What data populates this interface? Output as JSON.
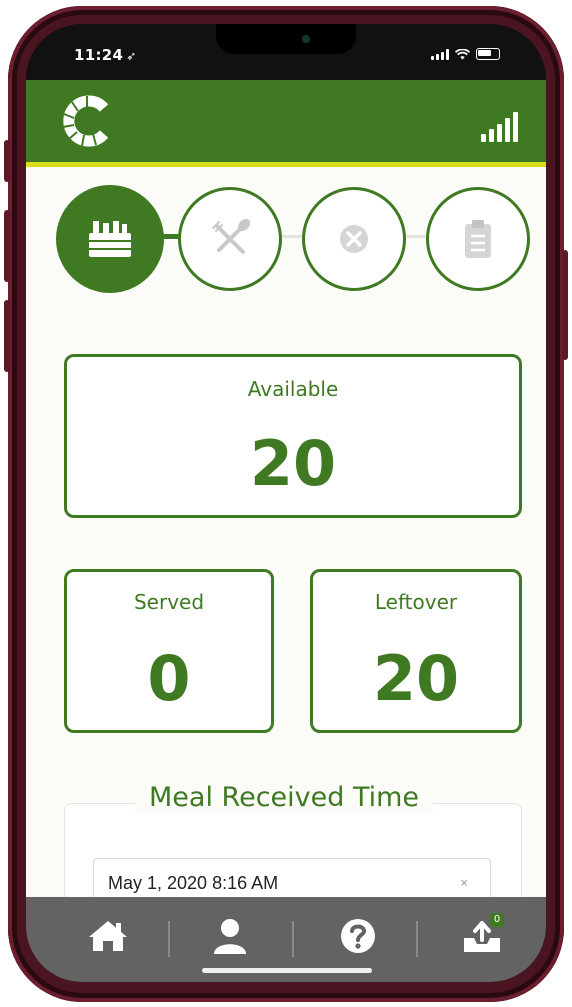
{
  "status_bar": {
    "time": "11:24",
    "location_arrow": "location-arrow-icon",
    "icons": [
      "cellular-signal-icon",
      "wifi-icon",
      "battery-icon"
    ]
  },
  "header": {
    "logo": "c-logo",
    "signal_icon": "signal-strength-icon",
    "brand_color": "#3f7a23",
    "accent_color": "#d8dc1a"
  },
  "steps": [
    {
      "icon": "meal-crate-icon",
      "state": "active"
    },
    {
      "icon": "fork-knife-icon",
      "state": "inactive"
    },
    {
      "icon": "cancel-icon",
      "state": "inactive"
    },
    {
      "icon": "clipboard-icon",
      "state": "inactive"
    }
  ],
  "cards": {
    "available": {
      "label": "Available",
      "value": "20"
    },
    "served": {
      "label": "Served",
      "value": "0"
    },
    "leftover": {
      "label": "Leftover",
      "value": "20"
    }
  },
  "meal_received": {
    "legend": "Meal Received Time",
    "value": "May 1, 2020 8:16 AM",
    "clear": "×"
  },
  "bottom_nav": {
    "items": [
      {
        "icon": "home-icon"
      },
      {
        "icon": "user-icon"
      },
      {
        "icon": "help-icon"
      },
      {
        "icon": "inbox-upload-icon",
        "badge": "0"
      }
    ]
  }
}
